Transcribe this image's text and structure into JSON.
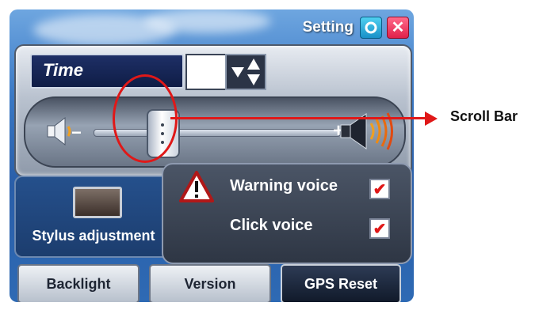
{
  "titlebar": {
    "title": "Setting",
    "settings_icon": "settings-icon",
    "close_icon": "close-icon",
    "close_glyph": "✕"
  },
  "time": {
    "label": "Time",
    "value": ""
  },
  "volume": {
    "minus": "−",
    "plus": "+",
    "level": 0.28
  },
  "stylus": {
    "label": "Stylus adjustment"
  },
  "voice": {
    "warning_label": "Warning voice",
    "warning_checked": true,
    "click_label": "Click voice",
    "click_checked": true,
    "check_glyph": "✔"
  },
  "buttons": {
    "backlight": "Backlight",
    "version": "Version",
    "gps_reset": "GPS Reset"
  },
  "annotation": {
    "label": "Scroll Bar"
  },
  "colors": {
    "accent": "#e01818"
  }
}
